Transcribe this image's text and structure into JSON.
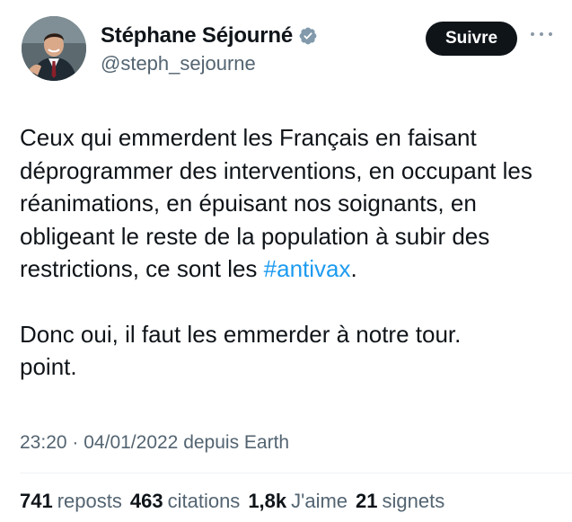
{
  "author": {
    "display_name": "Stéphane Séjourné",
    "handle": "@steph_sejourne",
    "verified_icon": "verified-badge-icon",
    "verified_color": "#829aab"
  },
  "header": {
    "follow_label": "Suivre",
    "more_icon": "more-horizontal-icon"
  },
  "tweet": {
    "text_part1": "Ceux qui emmerdent les Français en faisant déprogrammer des interventions, en occupant les réanimations, en épuisant nos soignants, en obligeant le reste de la population à subir des restrictions, ce sont les ",
    "hashtag": "#antivax",
    "text_part1_end": ".",
    "text_part2_line1": "Donc oui, il faut les emmerder à notre tour.",
    "text_part2_line2": "point.",
    "hashtag_color": "#1d9bf0"
  },
  "meta": {
    "time": "23:20",
    "separator": "·",
    "date": "04/01/2022",
    "source": "depuis Earth"
  },
  "stats": {
    "reposts_count": "741",
    "reposts_label": "reposts",
    "quotes_count": "463",
    "quotes_label": "citations",
    "likes_count": "1,8k",
    "likes_label": "J'aime",
    "bookmarks_count": "21",
    "bookmarks_label": "signets"
  }
}
